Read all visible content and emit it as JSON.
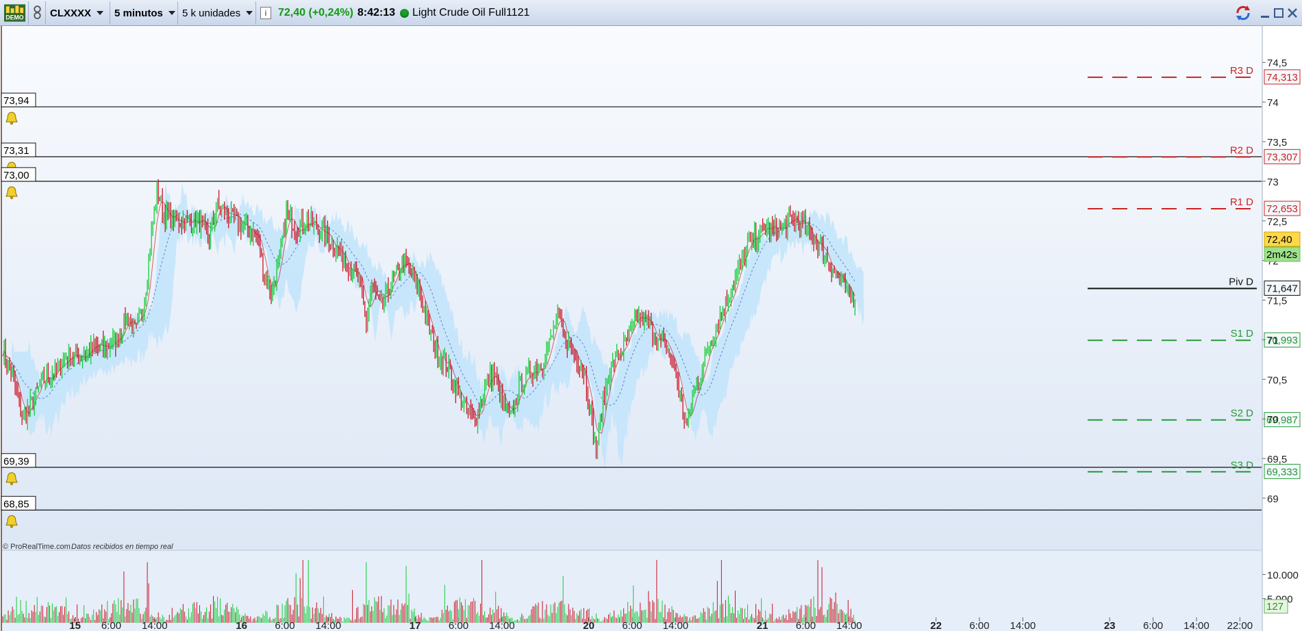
{
  "toolbar": {
    "demo_badge": "DEMO",
    "symbol": "CLXXXX",
    "timeframe": "5 minutos",
    "units": "5 k unidades",
    "info_icon": "i",
    "price_change": "72,40 (+0,24%)",
    "time": "8:42:13",
    "instrument": "Light Crude Oil Full1121",
    "colors": {
      "change": "#119911",
      "status_dot": "#1a9e2a"
    }
  },
  "watermark": "© ProRealTime.com",
  "realtime_note": "Datos recibidos en tiempo real",
  "price_tag": {
    "price": "72,40",
    "countdown": "2m42s"
  },
  "volume_tag": "127",
  "alert_lines": [
    {
      "label": "73,94",
      "value": 73.94
    },
    {
      "label": "73,31",
      "value": 73.31
    },
    {
      "label": "73,00",
      "value": 73.0
    },
    {
      "label": "69,39",
      "value": 69.39
    },
    {
      "label": "68,85",
      "value": 68.85
    }
  ],
  "pivots": [
    {
      "name": "R3 D",
      "label": "74,313",
      "value": 74.313,
      "color": "#cc2222",
      "style": "dashed"
    },
    {
      "name": "R2 D",
      "label": "73,307",
      "value": 73.307,
      "color": "#cc2222",
      "style": "dashed"
    },
    {
      "name": "R1 D",
      "label": "72,653",
      "value": 72.653,
      "color": "#cc2222",
      "style": "dashed"
    },
    {
      "name": "Piv D",
      "label": "71,647",
      "value": 71.647,
      "color": "#111111",
      "style": "solid"
    },
    {
      "name": "S1 D",
      "label": "70,993",
      "value": 70.993,
      "color": "#229933",
      "style": "dashed"
    },
    {
      "name": "S2 D",
      "label": "69,987",
      "value": 69.987,
      "color": "#229933",
      "style": "dashed"
    },
    {
      "name": "S3 D",
      "label": "69,333",
      "value": 69.333,
      "color": "#229933",
      "style": "dashed"
    }
  ],
  "chart_data": {
    "type": "line",
    "description_source": "5-minute candlestick price chart with Ichimoku-style cloud and volume histogram",
    "y_ticks": [
      {
        "label": "74,5",
        "value": 74.5
      },
      {
        "label": "74",
        "value": 74.0
      },
      {
        "label": "73,5",
        "value": 73.5
      },
      {
        "label": "73",
        "value": 73.0
      },
      {
        "label": "72,5",
        "value": 72.5
      },
      {
        "label": "72",
        "value": 72.0
      },
      {
        "label": "71,5",
        "value": 71.5
      },
      {
        "label": "71",
        "value": 71.0
      },
      {
        "label": "70,5",
        "value": 70.5
      },
      {
        "label": "70",
        "value": 70.0
      },
      {
        "label": "69,5",
        "value": 69.5
      },
      {
        "label": "69",
        "value": 69.0
      }
    ],
    "ylim": [
      68.74,
      74.96
    ],
    "volume_ticks": [
      {
        "label": "10.000",
        "value": 10000
      },
      {
        "label": "5.000",
        "value": 5000
      }
    ],
    "volume_ylim": [
      0,
      13600
    ],
    "x_ticks": [
      {
        "label": "15",
        "bold": true,
        "x": 12.5
      },
      {
        "label": "6:00",
        "x": 15.0
      },
      {
        "label": "14:00",
        "x": 18.0
      },
      {
        "label": "16",
        "bold": true,
        "x": 24.0
      },
      {
        "label": "6:00",
        "x": 27.0
      },
      {
        "label": "14:00",
        "x": 30.0
      },
      {
        "label": "17",
        "bold": true,
        "x": 36.0
      },
      {
        "label": "6:00",
        "x": 39.0
      },
      {
        "label": "14:00",
        "x": 42.0
      },
      {
        "label": "20",
        "bold": true,
        "x": 48.0
      },
      {
        "label": "6:00",
        "x": 51.0
      },
      {
        "label": "14:00",
        "x": 54.0
      },
      {
        "label": "21",
        "bold": true,
        "x": 60.0
      },
      {
        "label": "6:00",
        "x": 63.0
      },
      {
        "label": "14:00",
        "x": 66.0
      },
      {
        "label": "22",
        "bold": true,
        "x": 72.0
      },
      {
        "label": "6:00",
        "x": 75.0
      },
      {
        "label": "14:00",
        "x": 78.0
      },
      {
        "label": "23",
        "bold": true,
        "x": 84.0
      },
      {
        "label": "6:00",
        "x": 87.0
      },
      {
        "label": "14:00",
        "x": 90.0
      },
      {
        "label": "22:00",
        "x": 93.0
      }
    ],
    "xlim": [
      7.5,
      94.5
    ],
    "price_series": [
      [
        7.5,
        70.9
      ],
      [
        8.2,
        70.5
      ],
      [
        8.9,
        70.0
      ],
      [
        9.5,
        70.2
      ],
      [
        10.3,
        70.5
      ],
      [
        11.2,
        70.6
      ],
      [
        12.0,
        70.8
      ],
      [
        13.0,
        70.8
      ],
      [
        13.8,
        70.9
      ],
      [
        14.6,
        70.9
      ],
      [
        15.4,
        71.0
      ],
      [
        16.1,
        71.3
      ],
      [
        16.7,
        71.1
      ],
      [
        17.3,
        71.5
      ],
      [
        17.8,
        72.4
      ],
      [
        18.2,
        72.9
      ],
      [
        18.6,
        72.6
      ],
      [
        19.3,
        72.5
      ],
      [
        20.1,
        72.5
      ],
      [
        21.0,
        72.5
      ],
      [
        21.8,
        72.3
      ],
      [
        22.3,
        72.7
      ],
      [
        22.9,
        72.6
      ],
      [
        23.6,
        72.5
      ],
      [
        24.4,
        72.4
      ],
      [
        25.1,
        72.3
      ],
      [
        25.6,
        71.8
      ],
      [
        26.1,
        71.6
      ],
      [
        26.6,
        72.0
      ],
      [
        27.1,
        72.6
      ],
      [
        27.8,
        72.4
      ],
      [
        28.5,
        72.5
      ],
      [
        29.3,
        72.4
      ],
      [
        30.0,
        72.3
      ],
      [
        30.8,
        72.1
      ],
      [
        31.6,
        71.9
      ],
      [
        32.2,
        71.7
      ],
      [
        32.6,
        71.2
      ],
      [
        33.0,
        71.7
      ],
      [
        33.6,
        71.4
      ],
      [
        34.1,
        71.6
      ],
      [
        34.6,
        71.8
      ],
      [
        35.2,
        72.0
      ],
      [
        35.8,
        71.8
      ],
      [
        36.5,
        71.5
      ],
      [
        37.0,
        71.1
      ],
      [
        37.6,
        70.8
      ],
      [
        38.2,
        70.7
      ],
      [
        39.0,
        70.3
      ],
      [
        39.6,
        70.1
      ],
      [
        40.2,
        70.0
      ],
      [
        40.8,
        70.4
      ],
      [
        41.4,
        70.6
      ],
      [
        42.0,
        70.2
      ],
      [
        42.6,
        70.0
      ],
      [
        43.2,
        70.4
      ],
      [
        44.0,
        70.6
      ],
      [
        44.8,
        70.7
      ],
      [
        45.4,
        71.0
      ],
      [
        45.8,
        71.3
      ],
      [
        46.4,
        71.0
      ],
      [
        47.1,
        70.8
      ],
      [
        47.7,
        70.6
      ],
      [
        48.1,
        70.1
      ],
      [
        48.5,
        69.6
      ],
      [
        48.9,
        70.1
      ],
      [
        49.4,
        70.6
      ],
      [
        50.0,
        70.8
      ],
      [
        50.7,
        71.0
      ],
      [
        51.4,
        71.3
      ],
      [
        52.1,
        71.2
      ],
      [
        52.8,
        71.0
      ],
      [
        53.4,
        70.9
      ],
      [
        54.0,
        70.6
      ],
      [
        54.4,
        70.2
      ],
      [
        54.8,
        69.9
      ],
      [
        55.2,
        70.3
      ],
      [
        55.8,
        70.6
      ],
      [
        56.4,
        71.0
      ],
      [
        57.1,
        71.3
      ],
      [
        57.8,
        71.6
      ],
      [
        58.4,
        71.9
      ],
      [
        59.0,
        72.2
      ],
      [
        59.6,
        72.3
      ],
      [
        60.2,
        72.4
      ],
      [
        60.8,
        72.4
      ],
      [
        61.4,
        72.4
      ],
      [
        62.0,
        72.5
      ],
      [
        62.7,
        72.5
      ],
      [
        63.3,
        72.3
      ],
      [
        64.0,
        72.2
      ],
      [
        64.5,
        72.0
      ],
      [
        65.2,
        71.8
      ],
      [
        65.8,
        71.6
      ],
      [
        66.4,
        71.5
      ]
    ],
    "series_note": "Approximate close path read from the figure (x in day-hour axis units, y in price units).",
    "cloud_note": "Ichimoku-style shaded cloud (light blue / light red) around price.",
    "colors": {
      "bull": "#11cc33",
      "bear": "#cc1122",
      "cloud_up": "#bfe3fb",
      "cloud_down": "#f7d0d4",
      "plot_bg_top": "#f8fafd",
      "plot_bg_bottom": "#e3ebf6"
    }
  }
}
